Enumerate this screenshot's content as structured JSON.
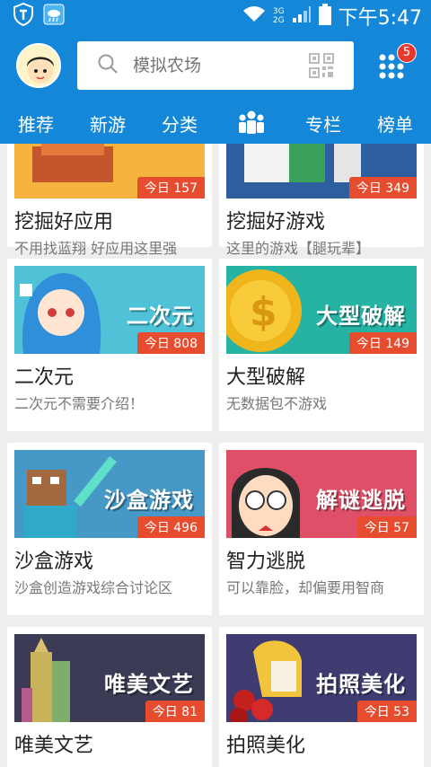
{
  "status_bar": {
    "network_top": "3G",
    "network_bottom": "2G",
    "time": "下午5:47"
  },
  "search": {
    "placeholder": "模拟农场"
  },
  "notifications": {
    "count": "5"
  },
  "tabs": [
    {
      "label": "推荐"
    },
    {
      "label": "新游"
    },
    {
      "label": "分类"
    },
    {
      "label": "",
      "icon": "community-icon"
    },
    {
      "label": "专栏"
    },
    {
      "label": "榜单"
    }
  ],
  "cards": [
    {
      "title": "挖掘好应用",
      "desc": "不用找蓝翔 好应用这里强",
      "today": "今日 157",
      "banner": "",
      "color": "#f3a93a"
    },
    {
      "title": "挖掘好游戏",
      "desc": "这里的游戏【腿玩辈】",
      "today": "今日 349",
      "banner": "",
      "color": "#3d6aa8"
    },
    {
      "title": "二次元",
      "desc": "二次元不需要介绍！",
      "today": "今日 808",
      "banner": "二次元",
      "color": "#4fc2d8"
    },
    {
      "title": "大型破解",
      "desc": "无数据包不游戏",
      "today": "今日 149",
      "banner": "大型破解",
      "color": "#27b3a4"
    },
    {
      "title": "沙盒游戏",
      "desc": "沙盒创造游戏综合讨论区",
      "today": "今日 496",
      "banner": "沙盒游戏",
      "color": "#4698c6"
    },
    {
      "title": "智力逃脱",
      "desc": "可以靠脸，却偏要用智商",
      "today": "今日 57",
      "banner": "解谜逃脱",
      "color": "#e04f68"
    },
    {
      "title": "唯美文艺",
      "desc": "",
      "today": "今日 81",
      "banner": "唯美文艺",
      "color": "#3b3b55"
    },
    {
      "title": "拍照美化",
      "desc": "",
      "today": "今日 53",
      "banner": "拍照美化",
      "color": "#3f3c72"
    }
  ]
}
